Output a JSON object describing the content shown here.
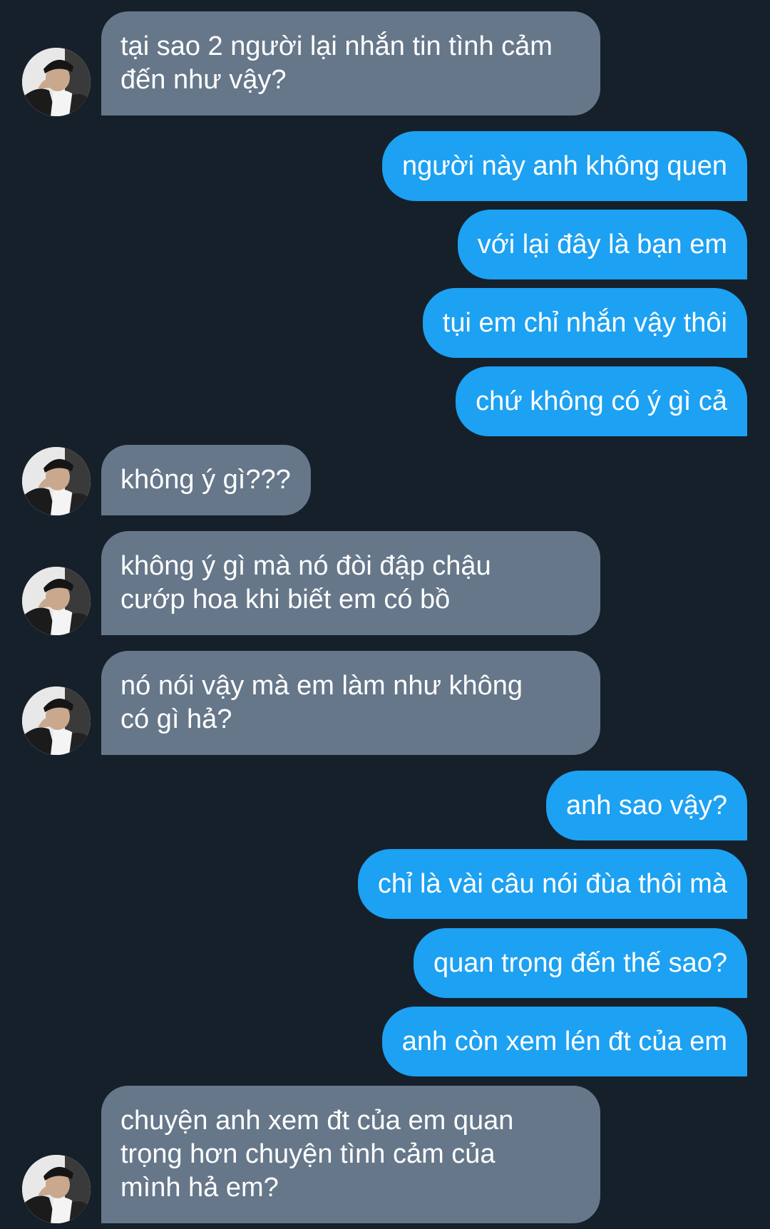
{
  "conversation": {
    "messages": [
      {
        "side": "in",
        "text": "tại sao 2 người lại nhắn tin tình cảm\nđến như vậy?",
        "avatar": true
      },
      {
        "side": "out",
        "text": "người này anh không quen"
      },
      {
        "side": "out",
        "text": "với lại đây là bạn em"
      },
      {
        "side": "out",
        "text": "tụi em chỉ nhắn vậy thôi"
      },
      {
        "side": "out",
        "text": "chứ không có ý gì cả"
      },
      {
        "side": "in",
        "text": "không ý gì???",
        "avatar": true
      },
      {
        "side": "in",
        "text": "không ý gì mà nó đòi đập chậu\ncướp hoa khi biết em có bồ",
        "avatar": true
      },
      {
        "side": "in",
        "text": "nó nói vậy mà em làm như không\ncó gì hả?",
        "avatar": true
      },
      {
        "side": "out",
        "text": "anh sao vậy?"
      },
      {
        "side": "out",
        "text": "chỉ là vài câu nói đùa thôi mà"
      },
      {
        "side": "out",
        "text": "quan trọng đến thế sao?"
      },
      {
        "side": "out",
        "text": "anh còn xem lén đt của em"
      },
      {
        "side": "in",
        "text": "chuyện anh xem đt của em quan\ntrọng hơn chuyện tình cảm của\nmình hả em?",
        "avatar": true
      }
    ],
    "colors": {
      "background": "#15202b",
      "incoming_bubble": "#66778a",
      "outgoing_bubble": "#1da1f2",
      "text": "#ffffff"
    },
    "avatar_icon": "profile-photo-avatar-icon"
  }
}
